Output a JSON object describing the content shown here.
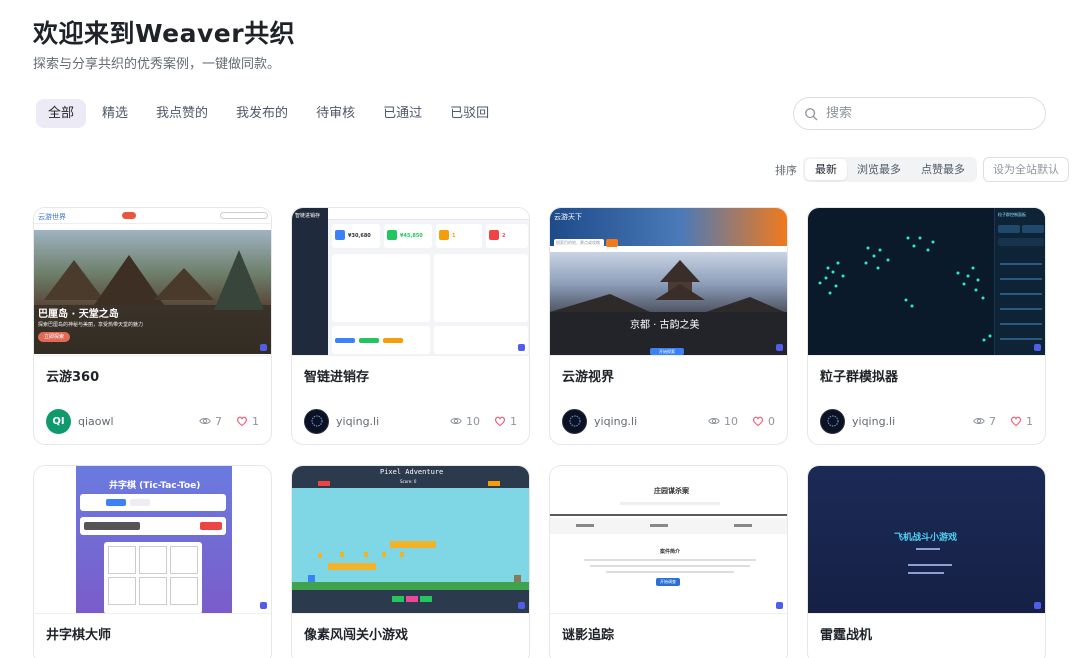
{
  "header": {
    "title": "欢迎来到Weaver共织",
    "subtitle": "探索与分享共织的优秀案例，一键做同款。"
  },
  "tabs": [
    "全部",
    "精选",
    "我点赞的",
    "我发布的",
    "待审核",
    "已通过",
    "已驳回"
  ],
  "search": {
    "placeholder": "搜索"
  },
  "sort": {
    "label": "排序",
    "options": [
      "最新",
      "浏览最多",
      "点赞最多"
    ],
    "default_button": "设为全站默认"
  },
  "cards": [
    {
      "title": "云游360",
      "author": "qiaowl",
      "avatar_text": "QI",
      "views": "7",
      "likes": "1",
      "thumb": {
        "brand": "云游世界",
        "hero": "巴厘岛 · 天堂之岛",
        "hero_sub": "探索巴厘岛的神秘与美丽，享受热带天堂的魅力",
        "cta": "立即探索"
      }
    },
    {
      "title": "智链进销存",
      "author": "yiqing.li",
      "views": "10",
      "likes": "1",
      "thumb": {
        "brand": "智链进销存",
        "stats": [
          "¥30,680",
          "¥45,850",
          "1",
          "2"
        ]
      }
    },
    {
      "title": "云游视界",
      "author": "yiqing.li",
      "views": "10",
      "likes": "0",
      "thumb": {
        "brand": "云游天下",
        "hero": "京都 · 古韵之美",
        "search": "搜索目的地、景点或攻略",
        "cta": "开始探索"
      }
    },
    {
      "title": "粒子群模拟器",
      "author": "yiqing.li",
      "views": "7",
      "likes": "1",
      "thumb": {
        "panel": "粒子群控制面板"
      }
    },
    {
      "title": "井字棋大师",
      "thumb": {
        "game_title": "井字棋 (Tic-Tac-Toe)"
      }
    },
    {
      "title": "像素风闯关小游戏",
      "thumb": {
        "game_title": "Pixel Adventure",
        "score": "Score: 0"
      }
    },
    {
      "title": "谜影追踪",
      "thumb": {
        "heading": "庄园谋杀案",
        "intro": "案件简介",
        "cta": "开始调查"
      }
    },
    {
      "title": "雷霆战机",
      "thumb": {
        "game_title": "飞机战斗小游戏"
      }
    }
  ],
  "colors": {
    "active_tab_bg": "#eceaf4",
    "brand_blue": "#4e5ee8",
    "like_red": "#f0506e"
  }
}
